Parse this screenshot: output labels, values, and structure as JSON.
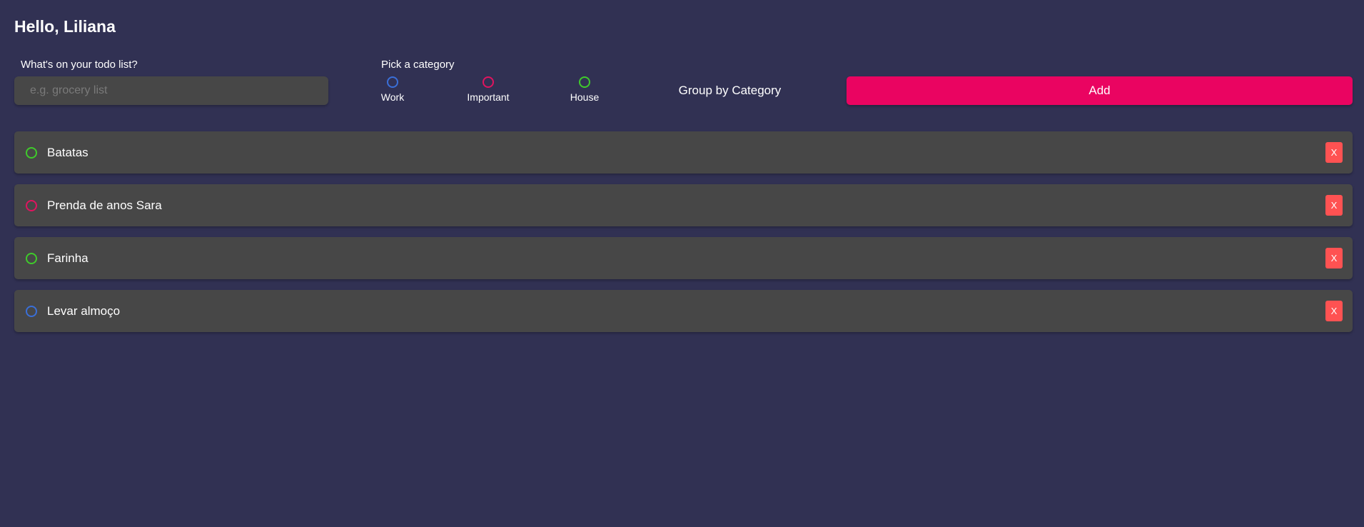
{
  "header": {
    "greeting": "Hello, Liliana"
  },
  "form": {
    "todo_label": "What's on your todo list?",
    "todo_placeholder": "e.g. grocery list",
    "todo_value": "",
    "category_label": "Pick a category",
    "categories": [
      {
        "label": "Work",
        "color": "#3a6fd8"
      },
      {
        "label": "Important",
        "color": "#e0145f"
      },
      {
        "label": "House",
        "color": "#3fcb2b"
      }
    ],
    "group_label": "Group by Category",
    "add_label": "Add"
  },
  "todos": [
    {
      "text": "Batatas",
      "category": "House",
      "color": "#3fcb2b",
      "delete_label": "X"
    },
    {
      "text": "Prenda de anos Sara",
      "category": "Important",
      "color": "#e0145f",
      "delete_label": "X"
    },
    {
      "text": "Farinha",
      "category": "House",
      "color": "#3fcb2b",
      "delete_label": "X"
    },
    {
      "text": "Levar almoço",
      "category": "Work",
      "color": "#3a6fd8",
      "delete_label": "X"
    }
  ],
  "colors": {
    "background": "#313153",
    "panel": "#474747",
    "accent": "#ea0461",
    "delete": "#ff5252"
  }
}
